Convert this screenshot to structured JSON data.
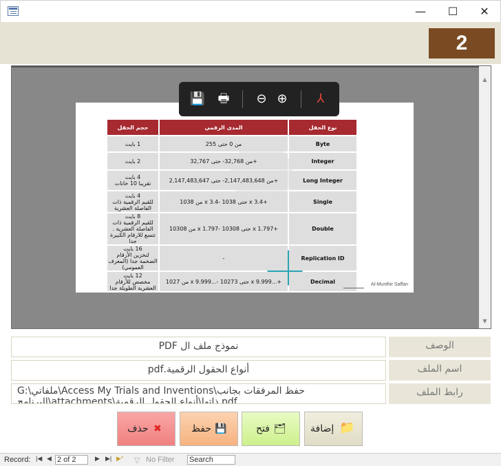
{
  "window": {
    "minimize": "—",
    "maximize": "☐",
    "close": "✕"
  },
  "record_number": "2",
  "pdf_toolbar": {
    "save": "💾",
    "print": "🖶",
    "zoom_out": "⊖",
    "zoom_in": "⊕",
    "acrobat": "⅄"
  },
  "table": {
    "headers": [
      "نوع الحقل",
      "المدى الرقمي",
      "حجم الحقل"
    ],
    "rows": [
      {
        "type": "Byte",
        "range": "من  0  حتى  255",
        "size": "1 بايت"
      },
      {
        "type": "Integer",
        "range": "من  32,768-  حتى  32,767+",
        "size": "2 بايت"
      },
      {
        "type": "Long Integer",
        "range": "من  2,147,483,648-  حتى  2,147,483,647+",
        "size": "4 بايت\nتقريبا 10 خانات"
      },
      {
        "type": "Single",
        "range": "من  1038 x 3.4-  حتى  1038 x 3.4+",
        "size": "4 بايت\nللقيم الرقمية ذات الفاصلة العشرية"
      },
      {
        "type": "Double",
        "range": "من  10308 x 1.797-  حتى  10308 x 1.797+",
        "size": "8 بايت\nللقيم الرقمية ذات الفاصلة العشرية . تتسع للارقام الكبيرة جدا"
      },
      {
        "type": "Replication ID",
        "range": "-",
        "size": "16 بايت\nلتخزين الأرقام الضخمة جدا (المعرف العمومي)"
      },
      {
        "type": "Decimal",
        "range": "من  1027 x 9.999...-  حتى  10273 x 9.999...+",
        "size": "12 بايت\nمخصص للأرقام العشرية الطويلة جدا"
      }
    ],
    "credit": "Al-Munthir Saffan"
  },
  "fields": [
    {
      "label": "الوصف",
      "value": "نموذج ملف ال PDF"
    },
    {
      "label": "اسم الملف",
      "value": "أنواع الحقول الرقمية.pdf"
    },
    {
      "label": "رابط الملف",
      "value": "G:\\ملفاتي\\Access My Trials and Inventions\\حفظ المرفقات بجانب البرنامج\\attachments\\ذاتها\\أنواع الحقول الرقمية.pdf"
    }
  ],
  "buttons": {
    "delete": "حذف",
    "save": "حفظ",
    "open": "فتح",
    "add": "إضافة"
  },
  "status": {
    "record_label": "Record:",
    "record_value": "2 of 2",
    "filter": "No Filter",
    "search": "Search"
  }
}
